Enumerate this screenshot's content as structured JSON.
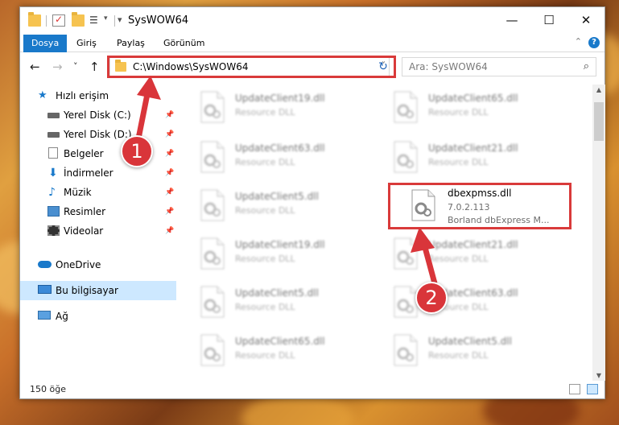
{
  "window": {
    "title": "SysWOW64"
  },
  "ribbon": {
    "tabs": [
      "Dosya",
      "Giriş",
      "Paylaş",
      "Görünüm"
    ],
    "help": "?"
  },
  "nav": {
    "back": "←",
    "forward": "→",
    "recent": "˅",
    "up": "↑",
    "refresh": "↻"
  },
  "address": {
    "path": "C:\\Windows\\SysWOW64"
  },
  "search": {
    "placeholder": "Ara: SysWOW64"
  },
  "sidebar": {
    "items": [
      {
        "label": "Hızlı erişim",
        "icon": "star-icon"
      },
      {
        "label": "Yerel Disk (C:)",
        "icon": "drive-icon"
      },
      {
        "label": "Yerel Disk (D:)",
        "icon": "drive-icon"
      },
      {
        "label": "Belgeler",
        "icon": "document-icon"
      },
      {
        "label": "İndirmeler",
        "icon": "download-icon"
      },
      {
        "label": "Müzik",
        "icon": "music-icon"
      },
      {
        "label": "Resimler",
        "icon": "pictures-icon"
      },
      {
        "label": "Videolar",
        "icon": "video-icon"
      },
      {
        "label": "OneDrive",
        "icon": "cloud-icon"
      },
      {
        "label": "Bu bilgisayar",
        "icon": "computer-icon"
      },
      {
        "label": "Ağ",
        "icon": "network-icon"
      }
    ]
  },
  "files": {
    "items": [
      {
        "name": "UpdateClient19.dll",
        "type": "Resource DLL"
      },
      {
        "name": "UpdateClient65.dll",
        "type": "Resource DLL"
      },
      {
        "name": "UpdateClient63.dll",
        "type": "Resource DLL"
      },
      {
        "name": "UpdateClient21.dll",
        "type": "Resource DLL"
      },
      {
        "name": "UpdateClient5.dll",
        "type": "Resource DLL"
      },
      {
        "name": "dbexpmss.dll",
        "type": "7.0.2.113",
        "desc": "Borland dbExpress M..."
      },
      {
        "name": "UpdateClient19.dll",
        "type": "Resource DLL"
      },
      {
        "name": "UpdateClient21.dll",
        "type": "Resource DLL"
      },
      {
        "name": "UpdateClient5.dll",
        "type": "Resource DLL"
      },
      {
        "name": "UpdateClient63.dll",
        "type": "Resource DLL"
      },
      {
        "name": "UpdateClient65.dll",
        "type": "Resource DLL"
      },
      {
        "name": "UpdateClient5.dll",
        "type": "Resource DLL"
      }
    ]
  },
  "status": {
    "count": "150 öğe"
  },
  "annotations": {
    "step1": "1",
    "step2": "2"
  },
  "colors": {
    "accent": "#1979ca",
    "annotation": "#d9353a",
    "selection": "#cde8ff"
  }
}
